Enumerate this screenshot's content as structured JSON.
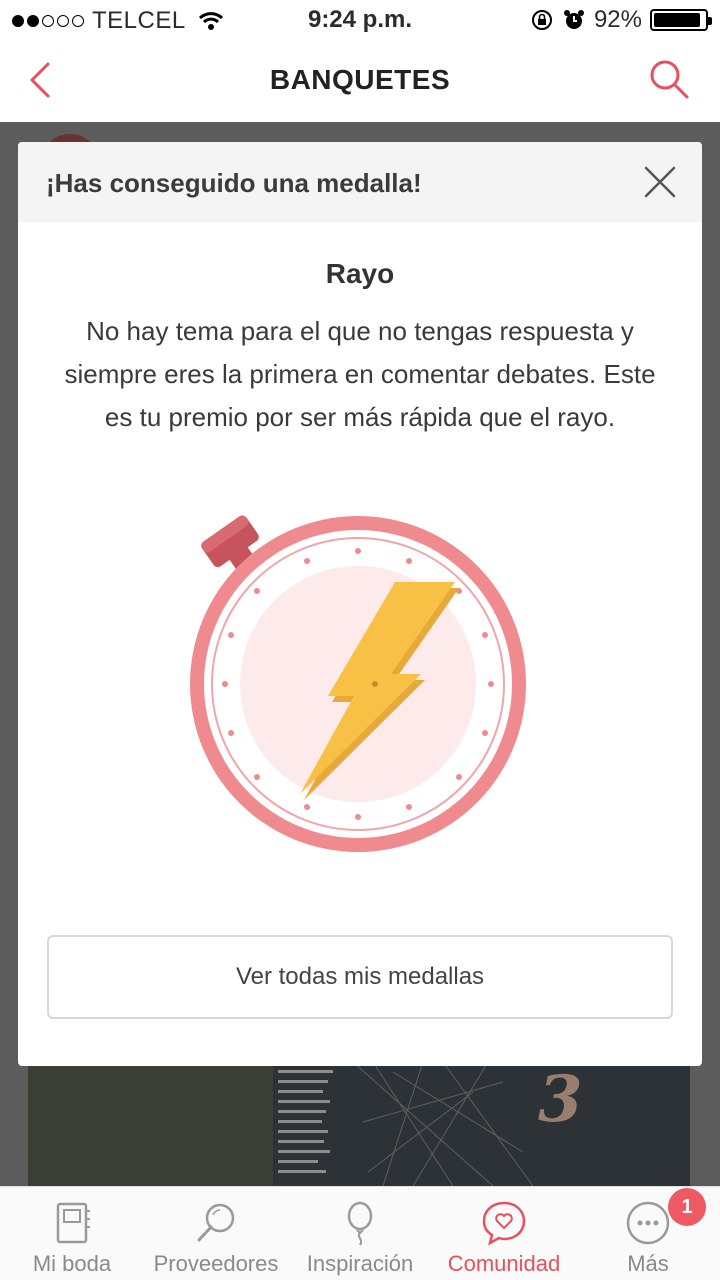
{
  "status_bar": {
    "carrier": "TELCEL",
    "time": "9:24 p.m.",
    "battery_percent": "92%",
    "battery_level": 0.92
  },
  "nav": {
    "title": "BANQUETES",
    "back_icon": "chevron-left-icon",
    "search_icon": "search-icon"
  },
  "modal": {
    "header_title": "¡Has conseguido una medalla!",
    "close_icon": "close-icon",
    "medal_name": "Rayo",
    "medal_description": "No hay tema para el que no tengas respuesta y siempre eres la primera en comentar debates. Este es tu premio por ser más rápida que el rayo.",
    "medal_icon": "stopwatch-lightning-icon",
    "button_label": "Ver todas mis medallas"
  },
  "tabs": [
    {
      "label": "Mi boda",
      "icon": "notebook-icon",
      "active": false
    },
    {
      "label": "Proveedores",
      "icon": "search-icon",
      "active": false
    },
    {
      "label": "Inspiración",
      "icon": "balloon-icon",
      "active": false
    },
    {
      "label": "Comunidad",
      "icon": "heart-chat-icon",
      "active": true
    },
    {
      "label": "Más",
      "icon": "more-icon",
      "active": false
    }
  ],
  "notification_badge": "1",
  "colors": {
    "accent": "#e8505b",
    "medal_ring": "#ef8a8e",
    "lightning": "#f8c145"
  }
}
